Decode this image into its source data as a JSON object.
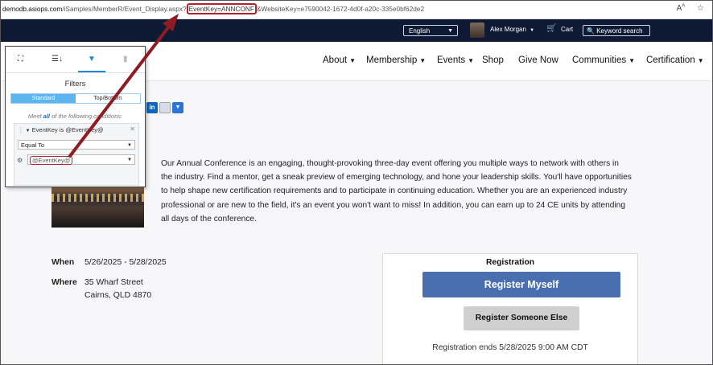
{
  "browser": {
    "url_host": "demodb.asiops.com",
    "url_path": "/iSamples/MemberR/Event_Display.aspx?",
    "url_highlight": "EventKey=ANNCONF",
    "url_rest": "&WebsiteKey=e7590042-1672-4d0f-a20c-335e0bf62de2"
  },
  "topbar": {
    "language": "English",
    "user_name": "Alex Morgan",
    "cart_label": "Cart",
    "keyword_search": "Keyword search"
  },
  "nav": {
    "items": [
      {
        "label": "About"
      },
      {
        "label": "Membership"
      },
      {
        "label": "Events"
      },
      {
        "label": "Shop"
      },
      {
        "label": "Give Now"
      },
      {
        "label": "Communities"
      },
      {
        "label": "Certification"
      }
    ]
  },
  "event": {
    "title_partial": "nce",
    "description": "Our Annual Conference is an engaging, thought-provoking three-day event offering you multiple ways to network with others in the industry. Find a mentor, get a sneak preview of emerging technology, and hone your leadership skills. You'll have opportunities to help shape new certification requirements and to participate in continuing education. Whether you are an experienced industry professional or are new to the field, it's an event you won't want to miss! In addition, you can earn up to 24 CE units by attending all days of the conference.",
    "when_label": "When",
    "when_value": "5/26/2025 - 5/28/2025",
    "where_label": "Where",
    "where_line1": "35 Wharf Street",
    "where_line2": "Cairns, QLD 4870"
  },
  "registration": {
    "title": "Registration",
    "register_myself": "Register Myself",
    "register_someone_else": "Register Someone Else",
    "ends": "Registration ends 5/28/2025 9:00 AM CDT"
  },
  "filter_panel": {
    "title": "Filters",
    "mode_standard": "Standard",
    "mode_topbottom": "Top/Bottom",
    "meet_prefix": "Meet ",
    "meet_all": "all",
    "meet_suffix": " of the following conditions:",
    "condition_head": "EventKey is @EventKey@",
    "operator": "Equal To",
    "value": "@EventKey@"
  },
  "colors": {
    "topbar": "#0e1a33",
    "primary_button": "#4a6fb0",
    "highlight_red": "#b3212a",
    "filter_accent": "#1e88d8"
  }
}
